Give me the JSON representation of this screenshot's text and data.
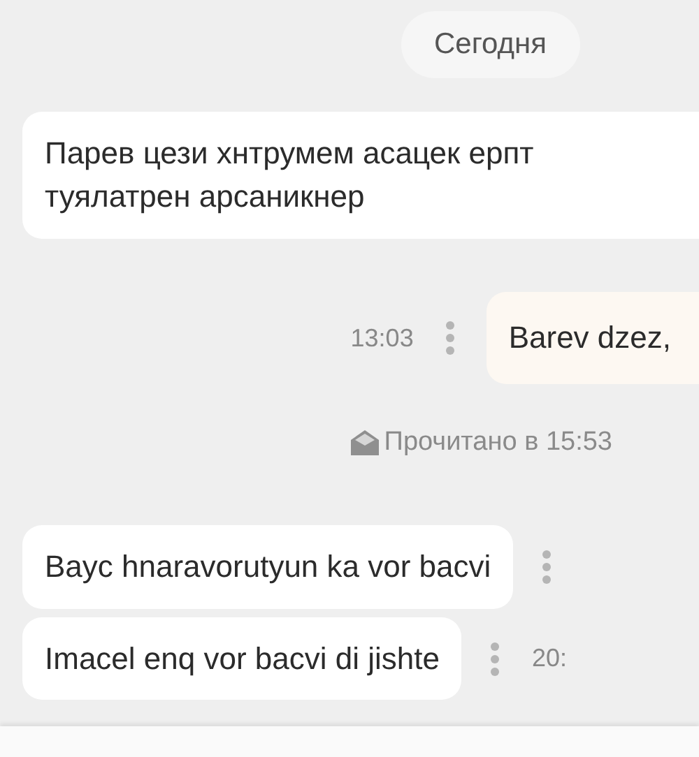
{
  "chat": [
    {
      "kind": "date",
      "text": "Сегодня"
    },
    {
      "kind": "incoming",
      "text": "Парев цези хнтрумем асацек ерпт\nтуялатрен арсаникнер"
    },
    {
      "kind": "outgoing",
      "text": "Barev dzez,",
      "time": "13:03",
      "menu": true
    },
    {
      "kind": "receipt",
      "text": "Прочитано в 15:53"
    },
    {
      "kind": "incoming",
      "text": "Bayc hnaravorutyun ka vor bacvi",
      "menu": true
    },
    {
      "kind": "incoming",
      "text": "Imacel enq vor bacvi di jishte",
      "menu": true,
      "time": "20:"
    }
  ]
}
